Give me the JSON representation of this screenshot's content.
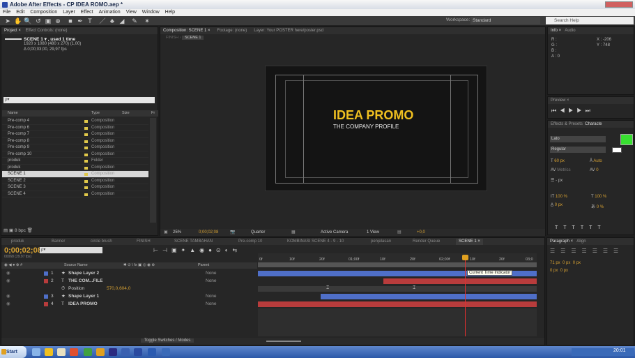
{
  "window": {
    "title": "Adobe After Effects - CP IDEA ROMO.aep *"
  },
  "menu": [
    "File",
    "Edit",
    "Composition",
    "Layer",
    "Effect",
    "Animation",
    "View",
    "Window",
    "Help"
  ],
  "toolbar": {
    "workspace_label": "Workspace:",
    "workspace_value": "Standard",
    "search_placeholder": "Search Help"
  },
  "project": {
    "tabs": [
      "Project ×",
      "Effect Controls: (none)"
    ],
    "comp_name": "SCENE 1 ▾ , used 1 time",
    "comp_info1": "1920 x 1080  (480 x 270) (1,00)",
    "comp_info2": "Δ 0;00;03;00, 29,97 fps",
    "search": "ρ▾",
    "col_name": "Name",
    "col_type": "Type",
    "col_size": "Size",
    "col_fr": "Fr",
    "items": [
      {
        "name": "Pre-comp 4",
        "type": "Composition"
      },
      {
        "name": "Pre-comp 6",
        "type": "Composition"
      },
      {
        "name": "Pre-comp 7",
        "type": "Composition"
      },
      {
        "name": "Pre-comp 8",
        "type": "Composition"
      },
      {
        "name": "Pre-comp 9",
        "type": "Composition"
      },
      {
        "name": "Pre-comp 10",
        "type": "Composition"
      },
      {
        "name": "produk",
        "type": "Folder"
      },
      {
        "name": "produk",
        "type": "Composition"
      },
      {
        "name": "SCENE 1",
        "type": "Composition"
      },
      {
        "name": "SCENE 2",
        "type": "Composition"
      },
      {
        "name": "SCENE 3",
        "type": "Composition"
      },
      {
        "name": "SCENE 4",
        "type": "Composition"
      }
    ],
    "bpc": "8 bpc"
  },
  "comp": {
    "tabs": [
      "Composition: SCENE 1 ×",
      "Footage: (none)",
      "Layer: Your POSTER here/poster.psd"
    ],
    "breadcrumb": [
      "FINISH",
      "SCENE 1"
    ],
    "title": "IDEA PROMO",
    "subtitle": "THE COMPANY PROFILE",
    "zoom": "25%",
    "timecode": "0;00;02;08",
    "res": "Quarter",
    "camera": "Active Camera",
    "view": "1 View",
    "exposure": "+0,0"
  },
  "info": {
    "tabs": [
      "Info ×",
      "Audio"
    ],
    "r": "R :",
    "g": "G :",
    "b": "B :",
    "a": "A : 0",
    "x": "X : -206",
    "y": "Y : 748"
  },
  "preview": {
    "tab": "Preview ×"
  },
  "effects": {
    "tabs": [
      "Effects & Presets",
      "Characte"
    ],
    "font": "Lato",
    "style": "Regular",
    "size": "60 px",
    "auto": "Auto",
    "metrics": "Metrics",
    "kern": "0",
    "px": "- px",
    "scale1": "100 %",
    "scale2": "100 %",
    "baseline": "0 px",
    "tsume": "0 %"
  },
  "paragraph": {
    "tabs": [
      "Paragraph ×",
      "Align"
    ],
    "v1": "71 px",
    "v2": "0 px",
    "v3": "0 px",
    "v4": "0 px",
    "v5": "0 px"
  },
  "timeline": {
    "tabs": [
      "produk",
      "Banner",
      "circle brush",
      "FINISH",
      "SCENE TAMBAHAN",
      "Pre-comp 10",
      "KOMBINASI SCENE 4 - 9 - 10",
      "penjelasan",
      "Render Queue",
      "SCENE 1 ×"
    ],
    "time": "0;00;02;08",
    "frames": "00068 (29.97 fps)",
    "col_source": "Source Name",
    "col_parent": "Parent",
    "ruler": [
      "0f",
      "10f",
      "20f",
      "01;00f",
      "10f",
      "20f",
      "02;00f",
      "10f",
      "20f",
      "03;0"
    ],
    "layers": [
      {
        "num": "1",
        "name": "Shape Layer 2",
        "parent": "None"
      },
      {
        "num": "2",
        "name": "THE COM...FILE",
        "parent": "None"
      },
      {
        "num": "",
        "name": "Position",
        "parent": "570,0,604,0"
      },
      {
        "num": "3",
        "name": "Shape Layer 1",
        "parent": "None"
      },
      {
        "num": "4",
        "name": "IDEA PROMO",
        "parent": "None"
      }
    ],
    "tooltip": "Current Time Indicator",
    "toggle": "Toggle Switches / Modes"
  },
  "taskbar": {
    "start": "Start",
    "clock": "20:01"
  },
  "colors": {
    "accent": "#f0c020",
    "blue_bar": "#4f6fc8",
    "red_bar": "#b83c3c",
    "cti": "#e0a020"
  }
}
